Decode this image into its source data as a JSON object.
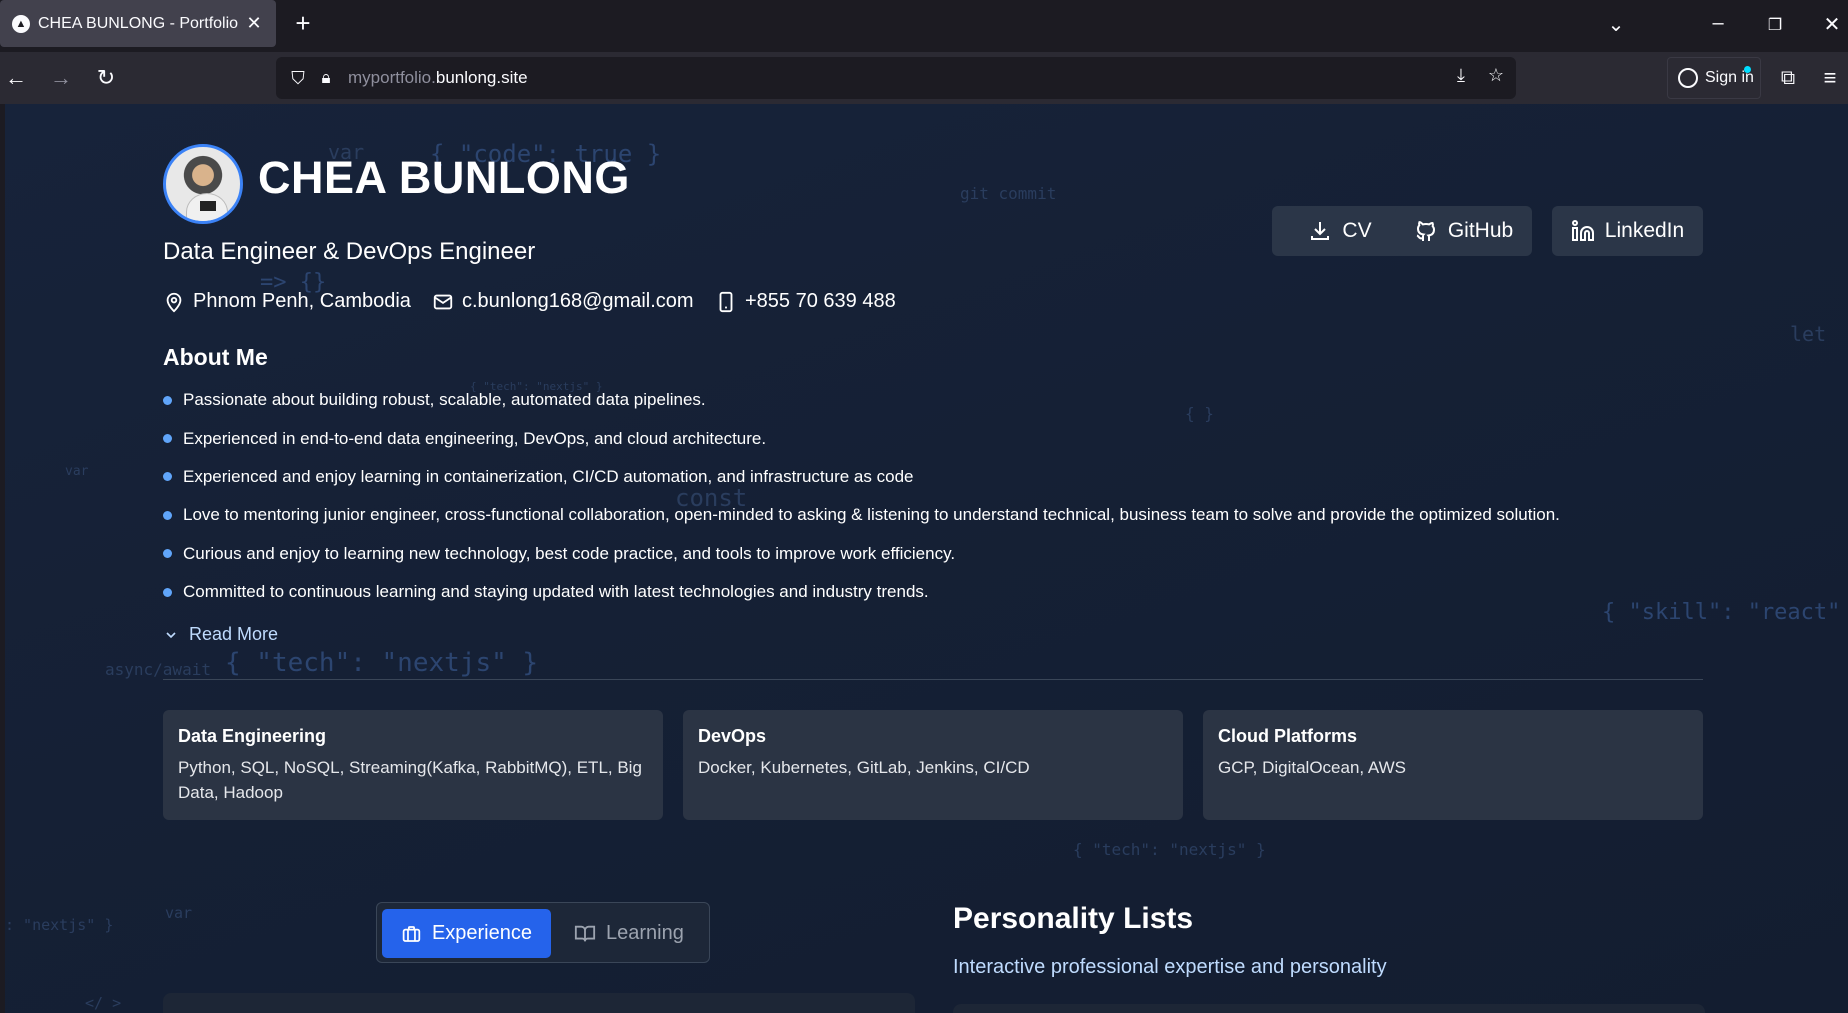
{
  "browser": {
    "tab_title": "CHEA BUNLONG - Portfolio",
    "tab_close": "✕",
    "new_tab": "+",
    "url_domain_prefix": "myportfolio.",
    "url_domain_main": "bunlong.site",
    "sign_in": "Sign in"
  },
  "header": {
    "name": "CHEA BUNLONG",
    "role": "Data Engineer & DevOps Engineer",
    "location": "Phnom Penh, Cambodia",
    "email": "c.bunlong168@gmail.com",
    "phone": "+855 70 639 488",
    "buttons": {
      "cv": "CV",
      "github": "GitHub",
      "linkedin": "LinkedIn"
    }
  },
  "about": {
    "heading": "About Me",
    "items": [
      "Passionate about building robust, scalable, automated data pipelines.",
      "Experienced in end-to-end data engineering, DevOps, and cloud architecture.",
      "Experienced and enjoy learning in containerization, CI/CD automation, and infrastructure as code",
      "Love to mentoring junior engineer, cross-functional collaboration, open-minded to asking & listening to understand technical, business team to solve and provide the optimized solution.",
      "Curious and enjoy to learning new technology, best code practice, and tools to improve work efficiency.",
      "Committed to continuous learning and staying updated with latest technologies and industry trends."
    ],
    "read_more": "Read More"
  },
  "skills": [
    {
      "title": "Data Engineering",
      "desc": "Python, SQL, NoSQL, Streaming(Kafka, RabbitMQ), ETL, Big Data, Hadoop"
    },
    {
      "title": "DevOps",
      "desc": "Docker, Kubernetes, GitLab, Jenkins, CI/CD"
    },
    {
      "title": "Cloud Platforms",
      "desc": "GCP, DigitalOcean, AWS"
    }
  ],
  "tabs": {
    "experience": "Experience",
    "learning": "Learning"
  },
  "personality": {
    "heading": "Personality Lists",
    "subtitle": "Interactive professional expertise and personality"
  },
  "background_code": [
    "var",
    "{ \"code\": true }",
    "git commit",
    "=> {}",
    "let",
    "{ \"tech\": \"nextjs\" }",
    "{ }",
    "var",
    "const",
    "{ \"skill\": \"react\"",
    "async/await",
    "{ \"tech\": \"nextjs\" }",
    "{ \"tech\": \"nextjs\" }",
    "var",
    ": \"nextjs\" }",
    "</ >"
  ],
  "colors": {
    "accent": "#2563eb",
    "bullet": "#60a5fa",
    "page_bg": "#152035",
    "card_bg": "#2b3444"
  }
}
